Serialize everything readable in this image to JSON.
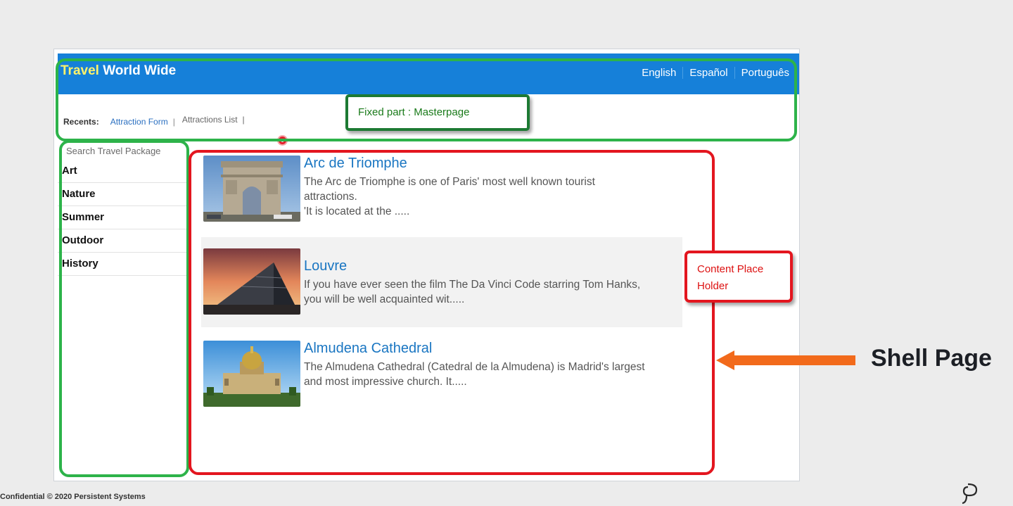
{
  "header": {
    "brand_accent": "Travel",
    "brand_rest": "World Wide",
    "languages": [
      "English",
      "Español",
      "Português"
    ]
  },
  "recents": {
    "label": "Recents:",
    "links": [
      "Attraction Form",
      "Attractions List"
    ],
    "separator": "|"
  },
  "sidebar": {
    "search_placeholder": "Search Travel Package",
    "categories": [
      "Art",
      "Nature",
      "Summer",
      "Outdoor",
      "History"
    ]
  },
  "attractions": [
    {
      "title": "Arc de Triomphe",
      "desc_lines": [
        "The Arc de Triomphe is one of Paris' most well known tourist",
        "attractions.",
        "'It is located at the ....."
      ]
    },
    {
      "title": "Louvre",
      "desc_lines": [
        "If you have ever seen the film The Da Vinci Code starring Tom Hanks,",
        "you will be well acquainted wit....."
      ]
    },
    {
      "title": "Almudena Cathedral",
      "desc_lines": [
        "The Almudena Cathedral (Catedral de la Almudena) is Madrid's largest",
        "and most impressive church. It....."
      ]
    }
  ],
  "annotations": {
    "fixed_part": "Fixed part : Masterpage",
    "content_line1": "Content Place",
    "content_line2": "Holder",
    "shell_page": "Shell Page"
  },
  "footer": {
    "text": "Confidential © 2020 Persistent Systems"
  },
  "colors": {
    "topbar": "#1680d9",
    "brand_accent": "#fff36a",
    "green_outline": "#2db34a",
    "red_outline": "#e3161f",
    "arrow": "#f26a1b",
    "link": "#1a76c2"
  }
}
